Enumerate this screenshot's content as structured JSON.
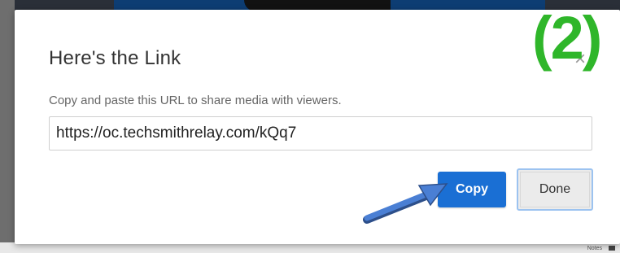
{
  "modal": {
    "title": "Here's the Link",
    "description": "Copy and paste this URL to share media with viewers.",
    "url_value": "https://oc.techsmithrelay.com/kQq7",
    "copy_label": "Copy",
    "done_label": "Done",
    "close_icon": "close-icon"
  },
  "annotation": {
    "step_label": "(2)",
    "step_color": "#2fb62a",
    "arrow_color": "#4a7fd4",
    "arrow_icon": "pointer-arrow-icon"
  },
  "background": {
    "notes_label": "Notes"
  },
  "colors": {
    "primary_button": "#1a6fd4",
    "focus_ring": "#9cc3f0"
  }
}
